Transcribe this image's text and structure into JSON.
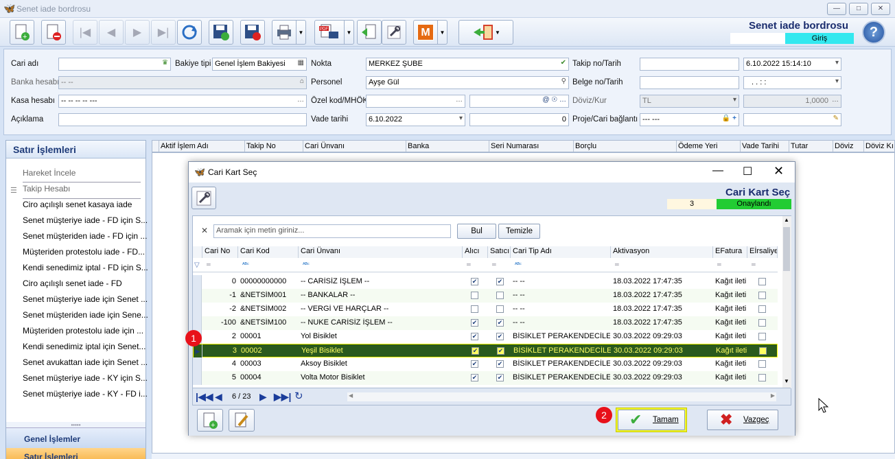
{
  "window": {
    "title": "Senet iade bordrosu"
  },
  "header": {
    "title": "Senet iade bordrosu",
    "mode": "Giriş"
  },
  "form": {
    "cari_adi_label": "Cari adı",
    "bakiye_tipi_label": "Bakiye tipi",
    "bakiye_tipi_value": "Genel İşlem Bakiyesi",
    "nokta_label": "Nokta",
    "nokta_value": "MERKEZ ŞUBE",
    "takip_label": "Takip no/Tarih",
    "takip_date": "6.10.2022 15:14:10",
    "banka_label": "Banka hesabı",
    "banka_value": "-- --",
    "personel_label": "Personel",
    "personel_value": "Ayşe Gül",
    "belge_label": "Belge no/Tarih",
    "belge_date": ". .    : :",
    "kasa_label": "Kasa hesabı",
    "kasa_value": "-- -- -- -- ---",
    "ozel_label": "Özel kod/MHÖK",
    "doviz_label": "Döviz/Kur",
    "doviz_value": "TL",
    "kur_value": "1,0000",
    "aciklama_label": "Açıklama",
    "vade_label": "Vade tarihi",
    "vade_value": "6.10.2022",
    "vade_days": "0",
    "proje_label": "Proje/Cari bağlantı",
    "proje_value": "--- ---"
  },
  "left_panel": {
    "title": "Satır İşlemleri",
    "items": [
      "Hareket İncele",
      "Takip Hesabı",
      "Ciro açılışlı senet kasaya iade",
      "Senet müşteriye iade - FD için S...",
      "Senet müşteriden iade - FD için ...",
      "Müşteriden protestolu iade - FD...",
      "Kendi senedimiz iptal - FD için S...",
      "Ciro açılışlı senet iade - FD",
      "Senet müşteriye iade için Senet ...",
      "Senet müşteriden iade için Sene...",
      "Müşteriden protestolu iade için ...",
      "Kendi senedimiz iptal için Senet...",
      "Senet avukattan iade için Senet ...",
      "Senet müşteriye iade - KY için S...",
      "Senet müşteriye iade - KY - FD i..."
    ],
    "group1": "Genel İşlemler",
    "group2": "Satır İşlemleri"
  },
  "main_columns": [
    "Aktif İşlem Adı",
    "Takip No",
    "Cari Ünvanı",
    "Banka",
    "Seri Numarası",
    "Borçlu",
    "Ödeme Yeri",
    "Vade Tarihi",
    "Tutar",
    "Döviz",
    "Döviz Kı"
  ],
  "dialog": {
    "title": "Cari Kart Seç",
    "header_title": "Cari Kart Seç",
    "count": "3",
    "status": "Onaylandı",
    "search_placeholder": "Aramak için metin giriniz...",
    "find_label": "Bul",
    "clear_label": "Temizle",
    "columns": [
      "Cari No",
      "Cari Kod",
      "Cari Ünvanı",
      "Alıcı",
      "Satıcı",
      "Cari Tip Adı",
      "Aktivasyon",
      "EFatura",
      "Eİrsaliye"
    ],
    "rows": [
      {
        "no": "0",
        "kod": "00000000000",
        "unvan": "-- CARİSİZ İŞLEM --",
        "alici": true,
        "satici": true,
        "tip": "-- --",
        "akt": "18.03.2022 17:47:35",
        "efat": "Kağıt iletir",
        "eirs": false
      },
      {
        "no": "-1",
        "kod": "&NETSİM001",
        "unvan": "-- BANKALAR --",
        "alici": false,
        "satici": false,
        "tip": "-- --",
        "akt": "18.03.2022 17:47:35",
        "efat": "Kağıt iletir",
        "eirs": false
      },
      {
        "no": "-2",
        "kod": "&NETSİM002",
        "unvan": "-- VERGİ VE HARÇLAR --",
        "alici": false,
        "satici": false,
        "tip": "-- --",
        "akt": "18.03.2022 17:47:35",
        "efat": "Kağıt iletir",
        "eirs": false
      },
      {
        "no": "-100",
        "kod": "&NETSİM100",
        "unvan": "-- NUKE CARİSİZ İŞLEM --",
        "alici": true,
        "satici": true,
        "tip": "-- --",
        "akt": "18.03.2022 17:47:35",
        "efat": "Kağıt iletir",
        "eirs": false
      },
      {
        "no": "2",
        "kod": "00001",
        "unvan": "Yol Bisiklet",
        "alici": true,
        "satici": true,
        "tip": "BİSİKLET PERAKENDECİLERİ",
        "akt": "30.03.2022 09:29:03",
        "efat": "Kağıt iletir",
        "eirs": false
      },
      {
        "no": "3",
        "kod": "00002",
        "unvan": "Yeşil Bisiklet",
        "alici": true,
        "satici": true,
        "tip": "BİSİKLET PERAKENDECİLERİ",
        "akt": "30.03.2022 09:29:03",
        "efat": "Kağıt iletir",
        "eirs": false
      },
      {
        "no": "4",
        "kod": "00003",
        "unvan": "Aksoy Bisiklet",
        "alici": true,
        "satici": true,
        "tip": "BİSİKLET PERAKENDECİLERİ",
        "akt": "30.03.2022 09:29:03",
        "efat": "Kağıt iletir",
        "eirs": false
      },
      {
        "no": "5",
        "kod": "00004",
        "unvan": "Volta Motor Bisiklet",
        "alici": true,
        "satici": true,
        "tip": "BİSİKLET PERAKENDECİLERİ",
        "akt": "30.03.2022 09:29:03",
        "efat": "Kağıt iletir",
        "eirs": false
      }
    ],
    "selected_index": 5,
    "pager": "6 / 23",
    "ok_label": "Tamam",
    "cancel_label": "Vazgeç"
  },
  "badges": [
    "1",
    "2"
  ],
  "colors": {
    "highlight": "#ffff00",
    "selected_row": "#2a5a1e",
    "onay": "#22cc33",
    "title_blue": "#1a2c6e"
  }
}
